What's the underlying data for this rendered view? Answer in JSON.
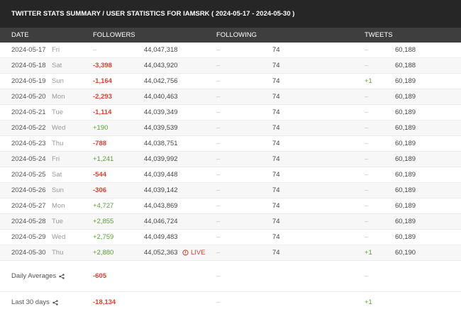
{
  "title": "TWITTER STATS SUMMARY / USER STATISTICS FOR IAMSRK ( 2024-05-17 - 2024-05-30 )",
  "columns": {
    "date": "DATE",
    "followers": "FOLLOWERS",
    "following": "FOLLOWING",
    "tweets": "TWEETS"
  },
  "rows": [
    {
      "date": "2024-05-17",
      "day": "Fri",
      "f_delta": "–",
      "f_total": "44,047,318",
      "fw_delta": "–",
      "fw_total": "74",
      "t_delta": "–",
      "t_total": "60,188"
    },
    {
      "date": "2024-05-18",
      "day": "Sat",
      "f_delta": "-3,398",
      "f_total": "44,043,920",
      "fw_delta": "–",
      "fw_total": "74",
      "t_delta": "–",
      "t_total": "60,188"
    },
    {
      "date": "2024-05-19",
      "day": "Sun",
      "f_delta": "-1,164",
      "f_total": "44,042,756",
      "fw_delta": "–",
      "fw_total": "74",
      "t_delta": "+1",
      "t_total": "60,189"
    },
    {
      "date": "2024-05-20",
      "day": "Mon",
      "f_delta": "-2,293",
      "f_total": "44,040,463",
      "fw_delta": "–",
      "fw_total": "74",
      "t_delta": "–",
      "t_total": "60,189"
    },
    {
      "date": "2024-05-21",
      "day": "Tue",
      "f_delta": "-1,114",
      "f_total": "44,039,349",
      "fw_delta": "–",
      "fw_total": "74",
      "t_delta": "–",
      "t_total": "60,189"
    },
    {
      "date": "2024-05-22",
      "day": "Wed",
      "f_delta": "+190",
      "f_total": "44,039,539",
      "fw_delta": "–",
      "fw_total": "74",
      "t_delta": "–",
      "t_total": "60,189"
    },
    {
      "date": "2024-05-23",
      "day": "Thu",
      "f_delta": "-788",
      "f_total": "44,038,751",
      "fw_delta": "–",
      "fw_total": "74",
      "t_delta": "–",
      "t_total": "60,189"
    },
    {
      "date": "2024-05-24",
      "day": "Fri",
      "f_delta": "+1,241",
      "f_total": "44,039,992",
      "fw_delta": "–",
      "fw_total": "74",
      "t_delta": "–",
      "t_total": "60,189"
    },
    {
      "date": "2024-05-25",
      "day": "Sat",
      "f_delta": "-544",
      "f_total": "44,039,448",
      "fw_delta": "–",
      "fw_total": "74",
      "t_delta": "–",
      "t_total": "60,189"
    },
    {
      "date": "2024-05-26",
      "day": "Sun",
      "f_delta": "-306",
      "f_total": "44,039,142",
      "fw_delta": "–",
      "fw_total": "74",
      "t_delta": "–",
      "t_total": "60,189"
    },
    {
      "date": "2024-05-27",
      "day": "Mon",
      "f_delta": "+4,727",
      "f_total": "44,043,869",
      "fw_delta": "–",
      "fw_total": "74",
      "t_delta": "–",
      "t_total": "60,189"
    },
    {
      "date": "2024-05-28",
      "day": "Tue",
      "f_delta": "+2,855",
      "f_total": "44,046,724",
      "fw_delta": "–",
      "fw_total": "74",
      "t_delta": "–",
      "t_total": "60,189"
    },
    {
      "date": "2024-05-29",
      "day": "Wed",
      "f_delta": "+2,759",
      "f_total": "44,049,483",
      "fw_delta": "–",
      "fw_total": "74",
      "t_delta": "–",
      "t_total": "60,189"
    },
    {
      "date": "2024-05-30",
      "day": "Thu",
      "f_delta": "+2,880",
      "f_total": "44,052,363",
      "fw_delta": "–",
      "fw_total": "74",
      "t_delta": "+1",
      "t_total": "60,190",
      "live": "LIVE"
    }
  ],
  "daily_averages": {
    "label": "Daily Averages",
    "f_delta": "-605",
    "fw_delta": "–",
    "t_delta": "–"
  },
  "last_30_days": {
    "label": "Last 30 days",
    "f_delta": "-18,134",
    "fw_delta": "–",
    "t_delta": "+1"
  },
  "colors": {
    "negative": "#d9432f",
    "positive": "#5aa032",
    "title_bg": "#262626",
    "header_bg": "#3e3e3e"
  }
}
